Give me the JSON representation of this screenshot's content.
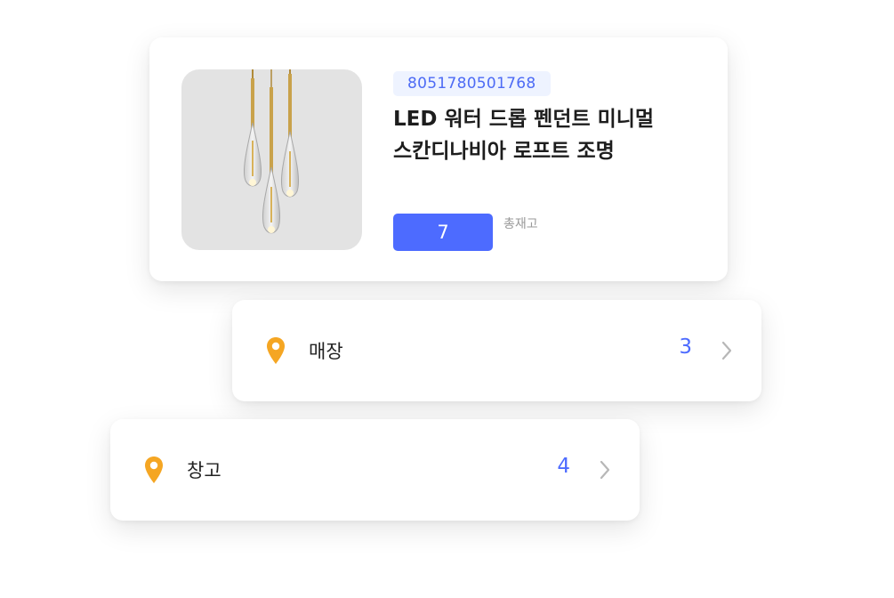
{
  "product": {
    "barcode": "8051780501768",
    "title": "LED 워터 드롭 펜던트 미니멀\n스칸디나비아 로프트 조명",
    "total_stock": "7",
    "total_stock_label": "총재고",
    "image_icon": "pendant-lamp-image"
  },
  "locations": [
    {
      "name": "매장",
      "count": "3",
      "icon": "location-pin-icon"
    },
    {
      "name": "창고",
      "count": "4",
      "icon": "location-pin-icon"
    }
  ],
  "colors": {
    "accent": "#4d6bff",
    "pin": "#f5a623",
    "badge_bg": "#eef3ff"
  }
}
